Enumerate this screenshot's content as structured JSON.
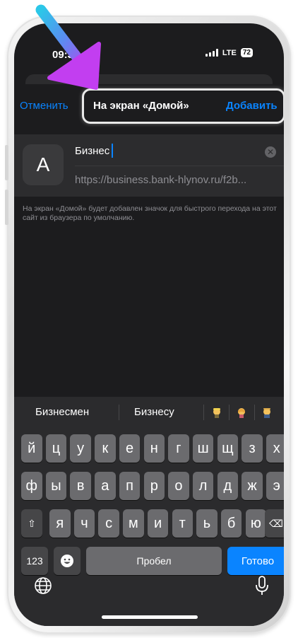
{
  "status_bar": {
    "time": "09:37",
    "network": "LTE",
    "battery": "72"
  },
  "nav": {
    "cancel_label": "Отменить",
    "title": "На экран «Домой»",
    "add_label": "Добавить"
  },
  "bookmark": {
    "icon_letter": "A",
    "name_value": "Бизнес",
    "url": "https://business.bank-hlynov.ru/f2b..."
  },
  "hint": "На экран «Домой» будет добавлен значок для быстрого перехода на этот сайт из браузера по умолчанию.",
  "keyboard": {
    "suggestions": [
      "Бизнесмен",
      "Бизнесу"
    ],
    "row1": [
      "й",
      "ц",
      "у",
      "к",
      "е",
      "н",
      "г",
      "ш",
      "щ",
      "з",
      "х"
    ],
    "row2": [
      "ф",
      "ы",
      "в",
      "а",
      "п",
      "р",
      "о",
      "л",
      "д",
      "ж",
      "э"
    ],
    "row3": [
      "я",
      "ч",
      "с",
      "м",
      "и",
      "т",
      "ь",
      "б",
      "ю"
    ],
    "numbers_label": "123",
    "space_label": "Пробел",
    "done_label": "Готово",
    "shift_symbol": "⇧",
    "delete_symbol": "⌫"
  },
  "icons": {
    "clear": "clear-icon",
    "emoji": "smiley-icon",
    "globe": "globe-icon",
    "mic": "microphone-icon"
  },
  "colors": {
    "accent": "#0a84ff",
    "background": "#1c1c1e",
    "arrow": "#b34bf2"
  }
}
